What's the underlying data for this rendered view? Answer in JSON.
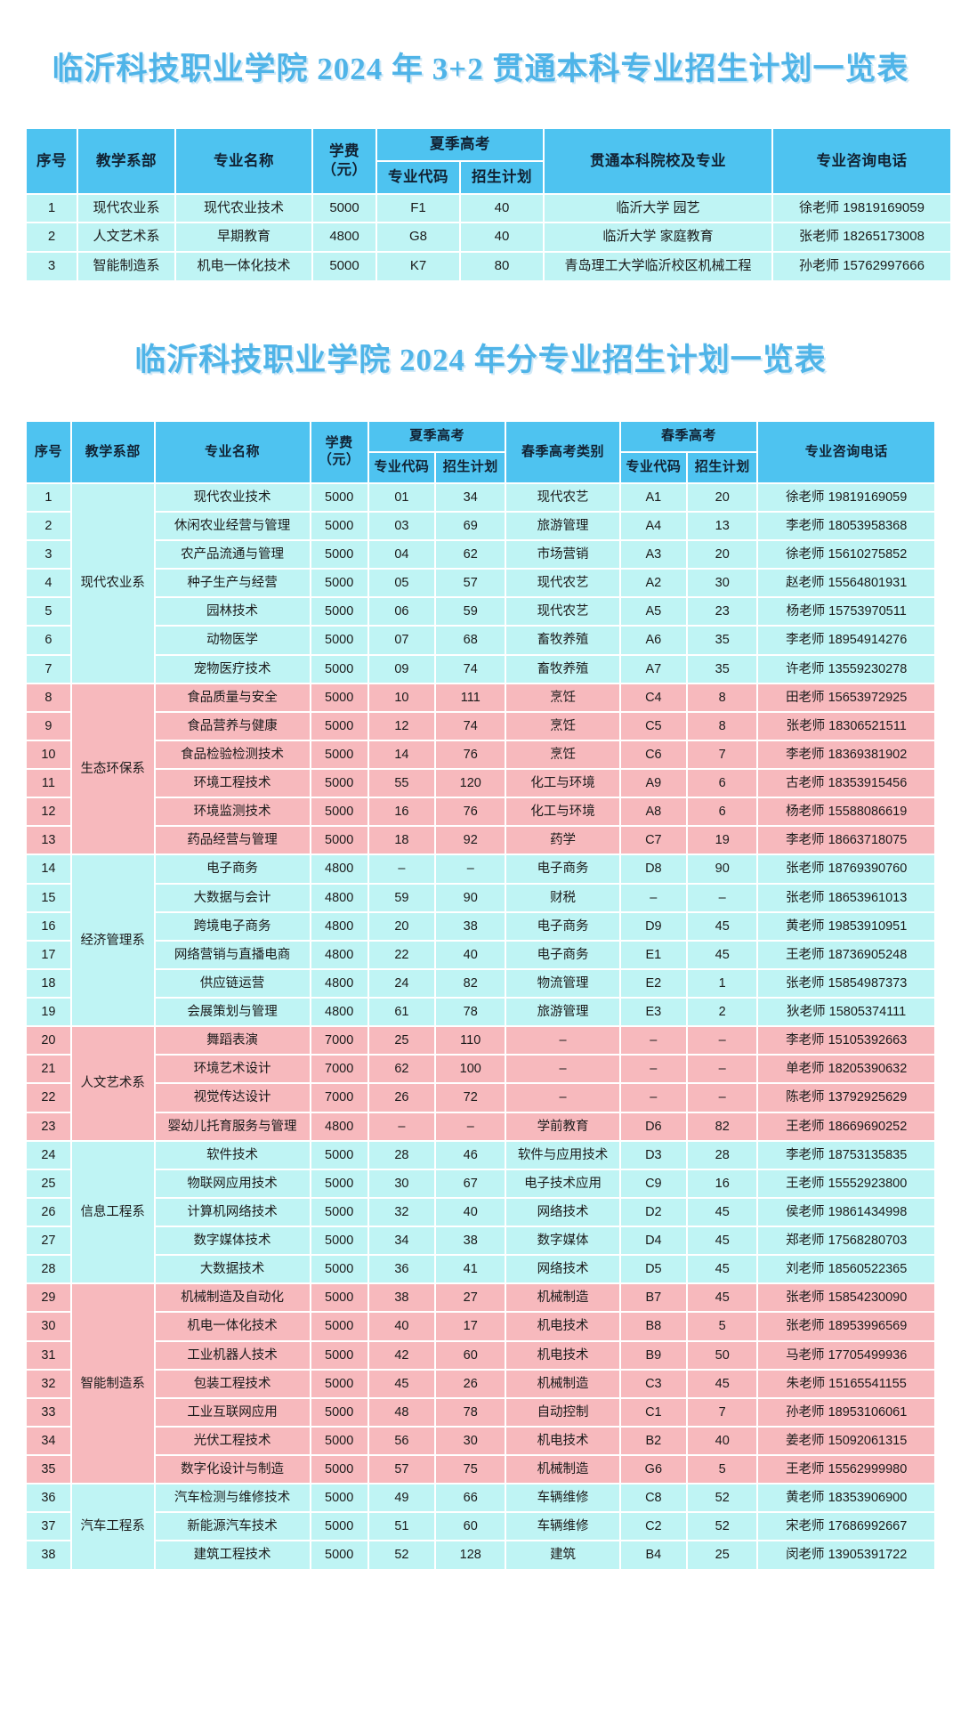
{
  "colors": {
    "title": "#4fb4e8",
    "header_bg": "#4ec3f0",
    "cyan_row": "#bff4f4",
    "pink_row": "#f7b9bd",
    "page_bg": "#ffffff"
  },
  "table1": {
    "title": "临沂科技职业学院 2024 年 3+2 贯通本科专业招生计划一览表",
    "headers": {
      "no": "序号",
      "dept": "教学系部",
      "major": "专业名称",
      "fee": "学费（元）",
      "fee_line1": "学费",
      "fee_line2": "（元）",
      "summer": "夏季高考",
      "summer_code": "专业代码",
      "summer_plan": "招生计划",
      "university": "贯通本科院校及专业",
      "tel": "专业咨询电话"
    },
    "rows": [
      {
        "no": "1",
        "dept": "现代农业系",
        "major": "现代农业技术",
        "fee": "5000",
        "summer_code": "F1",
        "summer_plan": "40",
        "university": "临沂大学 园艺",
        "tel": "徐老师 19819169059"
      },
      {
        "no": "2",
        "dept": "人文艺术系",
        "major": "早期教育",
        "fee": "4800",
        "summer_code": "G8",
        "summer_plan": "40",
        "university": "临沂大学 家庭教育",
        "tel": "张老师 18265173008"
      },
      {
        "no": "3",
        "dept": "智能制造系",
        "major": "机电一体化技术",
        "fee": "5000",
        "summer_code": "K7",
        "summer_plan": "80",
        "university": "青岛理工大学临沂校区机械工程",
        "tel": "孙老师 15762997666"
      }
    ]
  },
  "table2": {
    "title": "临沂科技职业学院 2024 年分专业招生计划一览表",
    "headers": {
      "no": "序号",
      "dept": "教学系部",
      "major": "专业名称",
      "fee_line1": "学费",
      "fee_line2": "（元）",
      "summer": "夏季高考",
      "summer_code": "专业代码",
      "summer_plan": "招生计划",
      "spring_type": "春季高考类别",
      "spring": "春季高考",
      "spring_code": "专业代码",
      "spring_plan": "招生计划",
      "tel": "专业咨询电话"
    },
    "groups": [
      {
        "dept": "现代农业系",
        "theme": "cyan",
        "rows": [
          {
            "no": "1",
            "major": "现代农业技术",
            "fee": "5000",
            "summer_code": "01",
            "summer_plan": "34",
            "spring_type": "现代农艺",
            "spring_code": "A1",
            "spring_plan": "20",
            "tel": "徐老师 19819169059"
          },
          {
            "no": "2",
            "major": "休闲农业经营与管理",
            "fee": "5000",
            "summer_code": "03",
            "summer_plan": "69",
            "spring_type": "旅游管理",
            "spring_code": "A4",
            "spring_plan": "13",
            "tel": "李老师 18053958368"
          },
          {
            "no": "3",
            "major": "农产品流通与管理",
            "fee": "5000",
            "summer_code": "04",
            "summer_plan": "62",
            "spring_type": "市场营销",
            "spring_code": "A3",
            "spring_plan": "20",
            "tel": "徐老师 15610275852"
          },
          {
            "no": "4",
            "major": "种子生产与经营",
            "fee": "5000",
            "summer_code": "05",
            "summer_plan": "57",
            "spring_type": "现代农艺",
            "spring_code": "A2",
            "spring_plan": "30",
            "tel": "赵老师 15564801931"
          },
          {
            "no": "5",
            "major": "园林技术",
            "fee": "5000",
            "summer_code": "06",
            "summer_plan": "59",
            "spring_type": "现代农艺",
            "spring_code": "A5",
            "spring_plan": "23",
            "tel": "杨老师 15753970511"
          },
          {
            "no": "6",
            "major": "动物医学",
            "fee": "5000",
            "summer_code": "07",
            "summer_plan": "68",
            "spring_type": "畜牧养殖",
            "spring_code": "A6",
            "spring_plan": "35",
            "tel": "李老师 18954914276"
          },
          {
            "no": "7",
            "major": "宠物医疗技术",
            "fee": "5000",
            "summer_code": "09",
            "summer_plan": "74",
            "spring_type": "畜牧养殖",
            "spring_code": "A7",
            "spring_plan": "35",
            "tel": "许老师 13559230278"
          }
        ]
      },
      {
        "dept": "生态环保系",
        "theme": "pink",
        "rows": [
          {
            "no": "8",
            "major": "食品质量与安全",
            "fee": "5000",
            "summer_code": "10",
            "summer_plan": "111",
            "spring_type": "烹饪",
            "spring_code": "C4",
            "spring_plan": "8",
            "tel": "田老师 15653972925"
          },
          {
            "no": "9",
            "major": "食品营养与健康",
            "fee": "5000",
            "summer_code": "12",
            "summer_plan": "74",
            "spring_type": "烹饪",
            "spring_code": "C5",
            "spring_plan": "8",
            "tel": "张老师 18306521511"
          },
          {
            "no": "10",
            "major": "食品检验检测技术",
            "fee": "5000",
            "summer_code": "14",
            "summer_plan": "76",
            "spring_type": "烹饪",
            "spring_code": "C6",
            "spring_plan": "7",
            "tel": "李老师 18369381902"
          },
          {
            "no": "11",
            "major": "环境工程技术",
            "fee": "5000",
            "summer_code": "55",
            "summer_plan": "120",
            "spring_type": "化工与环境",
            "spring_code": "A9",
            "spring_plan": "6",
            "tel": "古老师 18353915456"
          },
          {
            "no": "12",
            "major": "环境监测技术",
            "fee": "5000",
            "summer_code": "16",
            "summer_plan": "76",
            "spring_type": "化工与环境",
            "spring_code": "A8",
            "spring_plan": "6",
            "tel": "杨老师 15588086619"
          },
          {
            "no": "13",
            "major": "药品经营与管理",
            "fee": "5000",
            "summer_code": "18",
            "summer_plan": "92",
            "spring_type": "药学",
            "spring_code": "C7",
            "spring_plan": "19",
            "tel": "李老师 18663718075"
          }
        ]
      },
      {
        "dept": "经济管理系",
        "theme": "cyan",
        "rows": [
          {
            "no": "14",
            "major": "电子商务",
            "fee": "4800",
            "summer_code": "–",
            "summer_plan": "–",
            "spring_type": "电子商务",
            "spring_code": "D8",
            "spring_plan": "90",
            "tel": "张老师 18769390760"
          },
          {
            "no": "15",
            "major": "大数据与会计",
            "fee": "4800",
            "summer_code": "59",
            "summer_plan": "90",
            "spring_type": "财税",
            "spring_code": "–",
            "spring_plan": "–",
            "tel": "张老师 18653961013"
          },
          {
            "no": "16",
            "major": "跨境电子商务",
            "fee": "4800",
            "summer_code": "20",
            "summer_plan": "38",
            "spring_type": "电子商务",
            "spring_code": "D9",
            "spring_plan": "45",
            "tel": "黄老师 19853910951"
          },
          {
            "no": "17",
            "major": "网络营销与直播电商",
            "fee": "4800",
            "summer_code": "22",
            "summer_plan": "40",
            "spring_type": "电子商务",
            "spring_code": "E1",
            "spring_plan": "45",
            "tel": "王老师 18736905248"
          },
          {
            "no": "18",
            "major": "供应链运营",
            "fee": "4800",
            "summer_code": "24",
            "summer_plan": "82",
            "spring_type": "物流管理",
            "spring_code": "E2",
            "spring_plan": "1",
            "tel": "张老师 15854987373"
          },
          {
            "no": "19",
            "major": "会展策划与管理",
            "fee": "4800",
            "summer_code": "61",
            "summer_plan": "78",
            "spring_type": "旅游管理",
            "spring_code": "E3",
            "spring_plan": "2",
            "tel": "狄老师 15805374111"
          }
        ]
      },
      {
        "dept": "人文艺术系",
        "theme": "pink",
        "rows": [
          {
            "no": "20",
            "major": "舞蹈表演",
            "fee": "7000",
            "summer_code": "25",
            "summer_plan": "110",
            "spring_type": "–",
            "spring_code": "–",
            "spring_plan": "–",
            "tel": "李老师 15105392663"
          },
          {
            "no": "21",
            "major": "环境艺术设计",
            "fee": "7000",
            "summer_code": "62",
            "summer_plan": "100",
            "spring_type": "–",
            "spring_code": "–",
            "spring_plan": "–",
            "tel": "单老师 18205390632"
          },
          {
            "no": "22",
            "major": "视觉传达设计",
            "fee": "7000",
            "summer_code": "26",
            "summer_plan": "72",
            "spring_type": "–",
            "spring_code": "–",
            "spring_plan": "–",
            "tel": "陈老师 13792925629"
          },
          {
            "no": "23",
            "major": "婴幼儿托育服务与管理",
            "fee": "4800",
            "summer_code": "–",
            "summer_plan": "–",
            "spring_type": "学前教育",
            "spring_code": "D6",
            "spring_plan": "82",
            "tel": "王老师 18669690252"
          }
        ]
      },
      {
        "dept": "信息工程系",
        "theme": "cyan",
        "rows": [
          {
            "no": "24",
            "major": "软件技术",
            "fee": "5000",
            "summer_code": "28",
            "summer_plan": "46",
            "spring_type": "软件与应用技术",
            "spring_code": "D3",
            "spring_plan": "28",
            "tel": "李老师 18753135835"
          },
          {
            "no": "25",
            "major": "物联网应用技术",
            "fee": "5000",
            "summer_code": "30",
            "summer_plan": "67",
            "spring_type": "电子技术应用",
            "spring_code": "C9",
            "spring_plan": "16",
            "tel": "王老师 15552923800"
          },
          {
            "no": "26",
            "major": "计算机网络技术",
            "fee": "5000",
            "summer_code": "32",
            "summer_plan": "40",
            "spring_type": "网络技术",
            "spring_code": "D2",
            "spring_plan": "45",
            "tel": "侯老师 19861434998"
          },
          {
            "no": "27",
            "major": "数字媒体技术",
            "fee": "5000",
            "summer_code": "34",
            "summer_plan": "38",
            "spring_type": "数字媒体",
            "spring_code": "D4",
            "spring_plan": "45",
            "tel": "郑老师 17568280703"
          },
          {
            "no": "28",
            "major": "大数据技术",
            "fee": "5000",
            "summer_code": "36",
            "summer_plan": "41",
            "spring_type": "网络技术",
            "spring_code": "D5",
            "spring_plan": "45",
            "tel": "刘老师 18560522365"
          }
        ]
      },
      {
        "dept": "智能制造系",
        "theme": "pink",
        "rows": [
          {
            "no": "29",
            "major": "机械制造及自动化",
            "fee": "5000",
            "summer_code": "38",
            "summer_plan": "27",
            "spring_type": "机械制造",
            "spring_code": "B7",
            "spring_plan": "45",
            "tel": "张老师 15854230090"
          },
          {
            "no": "30",
            "major": "机电一体化技术",
            "fee": "5000",
            "summer_code": "40",
            "summer_plan": "17",
            "spring_type": "机电技术",
            "spring_code": "B8",
            "spring_plan": "5",
            "tel": "张老师 18953996569"
          },
          {
            "no": "31",
            "major": "工业机器人技术",
            "fee": "5000",
            "summer_code": "42",
            "summer_plan": "60",
            "spring_type": "机电技术",
            "spring_code": "B9",
            "spring_plan": "50",
            "tel": "马老师 17705499936"
          },
          {
            "no": "32",
            "major": "包装工程技术",
            "fee": "5000",
            "summer_code": "45",
            "summer_plan": "26",
            "spring_type": "机械制造",
            "spring_code": "C3",
            "spring_plan": "45",
            "tel": "朱老师 15165541155"
          },
          {
            "no": "33",
            "major": "工业互联网应用",
            "fee": "5000",
            "summer_code": "48",
            "summer_plan": "78",
            "spring_type": "自动控制",
            "spring_code": "C1",
            "spring_plan": "7",
            "tel": "孙老师 18953106061"
          },
          {
            "no": "34",
            "major": "光伏工程技术",
            "fee": "5000",
            "summer_code": "56",
            "summer_plan": "30",
            "spring_type": "机电技术",
            "spring_code": "B2",
            "spring_plan": "40",
            "tel": "姜老师 15092061315"
          },
          {
            "no": "35",
            "major": "数字化设计与制造",
            "fee": "5000",
            "summer_code": "57",
            "summer_plan": "75",
            "spring_type": "机械制造",
            "spring_code": "G6",
            "spring_plan": "5",
            "tel": "王老师 15562999980"
          }
        ]
      },
      {
        "dept": "汽车工程系",
        "theme": "cyan",
        "rows": [
          {
            "no": "36",
            "major": "汽车检测与维修技术",
            "fee": "5000",
            "summer_code": "49",
            "summer_plan": "66",
            "spring_type": "车辆维修",
            "spring_code": "C8",
            "spring_plan": "52",
            "tel": "黄老师 18353906900"
          },
          {
            "no": "37",
            "major": "新能源汽车技术",
            "fee": "5000",
            "summer_code": "51",
            "summer_plan": "60",
            "spring_type": "车辆维修",
            "spring_code": "C2",
            "spring_plan": "52",
            "tel": "宋老师 17686992667"
          },
          {
            "no": "38",
            "major": "建筑工程技术",
            "fee": "5000",
            "summer_code": "52",
            "summer_plan": "128",
            "spring_type": "建筑",
            "spring_code": "B4",
            "spring_plan": "25",
            "tel": "闵老师 13905391722"
          }
        ]
      }
    ]
  }
}
